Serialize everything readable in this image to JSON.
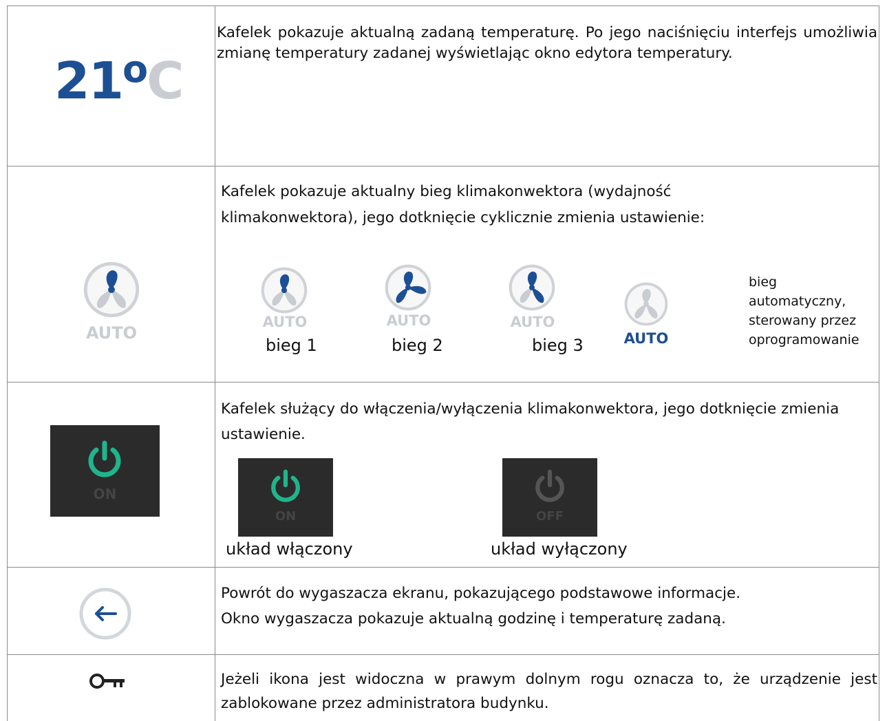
{
  "rows": {
    "temperature": {
      "value": "21",
      "deg": "o",
      "unit": "C",
      "text": "Kafelek pokazuje aktualną zadaną temperaturę. Po jego naciśnięciu interfejs umożliwia zmianę temperatury zadanej wyświetlając okno edytora temperatury."
    },
    "fan": {
      "text": "Kafelek pokazuje aktualny bieg klimakonwektora (wydajność klimakonwektora), jego dotknięcie cyklicznie zmienia ustawienie:",
      "tile_label": "AUTO",
      "speeds": [
        {
          "icon_label": "AUTO",
          "caption": "bieg 1"
        },
        {
          "icon_label": "AUTO",
          "caption": "bieg 2"
        },
        {
          "icon_label": "AUTO",
          "caption": "bieg 3"
        },
        {
          "icon_label": "AUTO",
          "caption": ""
        }
      ],
      "auto_desc_lines": [
        "bieg",
        "automatyczny,",
        "sterowany przez",
        "oprogramowanie"
      ]
    },
    "power": {
      "tile_label": "ON",
      "text": "Kafelek służący do włączenia/wyłączenia klimakonwektora, jego dotknięcie zmienia ustawienie.",
      "on_label": "ON",
      "off_label": "OFF",
      "on_caption": "układ włączony",
      "off_caption": "układ wyłączony"
    },
    "back": {
      "line1": "Powrót do wygaszacza ekranu, pokazującego podstawowe informacje.",
      "line2": "Okno wygaszacza pokazuje aktualną godzinę i temperaturę zadaną."
    },
    "lock": {
      "text": "Jeżeli ikona jest widoczna w prawym dolnym rogu oznacza to, że urządzenie jest zablokowane przez administratora budynku."
    }
  },
  "colors": {
    "blue": "#1d4f95",
    "grey": "#c9cdd2",
    "green": "#1fb58c",
    "dark_tile": "#2b2b2b"
  }
}
